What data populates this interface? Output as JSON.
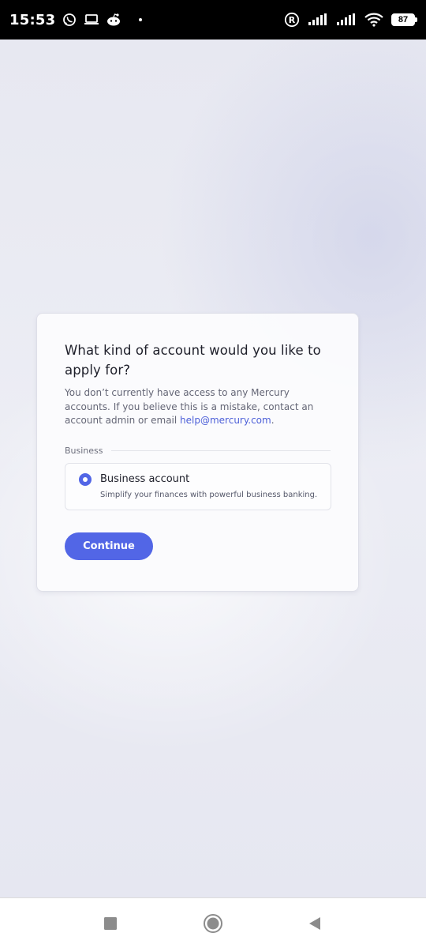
{
  "status_bar": {
    "time": "15:53",
    "battery": "87",
    "icons": [
      "whatsapp-icon",
      "laptop-icon",
      "reddit-icon",
      "registered-icon",
      "signal-icon",
      "signal-icon-2",
      "wifi-icon",
      "battery-icon"
    ]
  },
  "card": {
    "title": "What kind of account would you like to apply for?",
    "desc_text": "You don’t currently have access to any Mercury accounts. If you believe this is a mistake, contact an account admin or email ",
    "email_link": "help@mercury.com",
    "desc_end": ".",
    "section_label": "Business",
    "option": {
      "title": "Business account",
      "subtitle": "Simplify your finances with powerful business banking.",
      "selected": true
    },
    "continue_label": "Continue"
  },
  "colors": {
    "accent": "#5266e6",
    "link": "#4c5fd8",
    "text": "#1e1f2a",
    "muted": "#646676"
  },
  "nav_bar": {
    "icons": [
      "recents-square-icon",
      "home-circle-icon",
      "back-triangle-icon"
    ]
  }
}
